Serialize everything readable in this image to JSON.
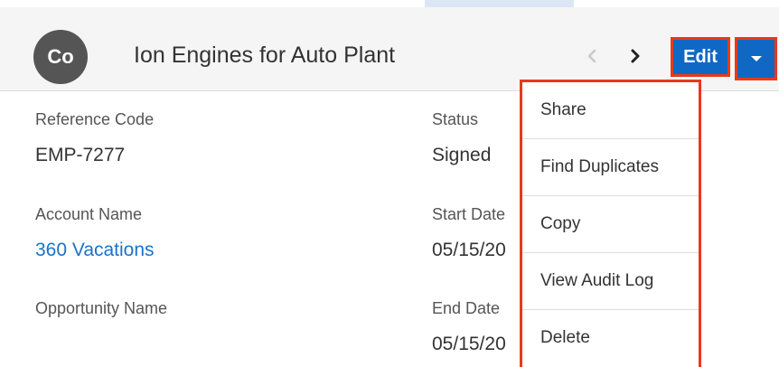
{
  "header": {
    "avatar_initials": "Co",
    "title": "Ion Engines for Auto Plant",
    "prev_icon": "chevron-left-icon",
    "next_icon": "chevron-right-icon",
    "edit_label": "Edit",
    "actions_icon": "caret-down-icon"
  },
  "fields": {
    "reference_code": {
      "label": "Reference Code",
      "value": "EMP-7277"
    },
    "status": {
      "label": "Status",
      "value": "Signed"
    },
    "account_name": {
      "label": "Account Name",
      "value": "360 Vacations"
    },
    "start_date": {
      "label": "Start Date",
      "value": "05/15/20"
    },
    "opportunity_name": {
      "label": "Opportunity Name",
      "value": ""
    },
    "end_date": {
      "label": "End Date",
      "value": "05/15/20"
    }
  },
  "actions_menu": {
    "items": [
      {
        "label": "Share"
      },
      {
        "label": "Find Duplicates"
      },
      {
        "label": "Copy"
      },
      {
        "label": "View Audit Log"
      },
      {
        "label": "Delete"
      }
    ]
  },
  "colors": {
    "primary": "#0f69c4",
    "highlight": "#e8391a",
    "link": "#1a73c8",
    "avatar_bg": "#555555"
  }
}
